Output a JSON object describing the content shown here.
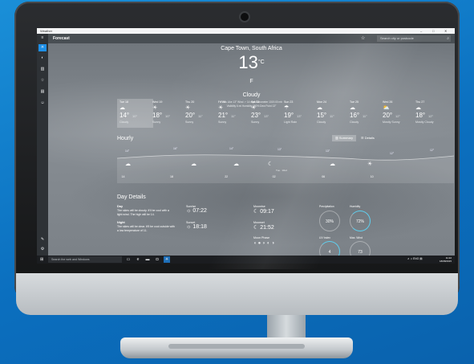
{
  "window": {
    "title": "Weather",
    "min": "–",
    "max": "□",
    "close": "✕"
  },
  "app": {
    "section": "Forecast",
    "search_placeholder": "Search city or postcode"
  },
  "current": {
    "location": "Cape Town, South Africa",
    "temp": "13",
    "unit_c": "°C",
    "unit_f": "F",
    "condition": "Cloudy",
    "stats_line1": "Feels Like 13°   Wind ↗ 14 mph   Barometer 1019.00 mb",
    "stats_line2": "Visibility 6 mi   Humidity 100%   Dew Point 13°"
  },
  "daily": [
    {
      "day": "Tue 18",
      "icon": "☁",
      "hi": "14°",
      "lo": "10°",
      "cond": "Cloudy"
    },
    {
      "day": "Wed 19",
      "icon": "☀",
      "hi": "18°",
      "lo": "10°",
      "cond": "Sunny"
    },
    {
      "day": "Thu 20",
      "icon": "☀",
      "hi": "20°",
      "lo": "11°",
      "cond": "Sunny"
    },
    {
      "day": "Fri 21",
      "icon": "☀",
      "hi": "21°",
      "lo": "11°",
      "cond": "Sunny"
    },
    {
      "day": "Sat 22",
      "icon": "☀",
      "hi": "23°",
      "lo": "13°",
      "cond": "Sunny"
    },
    {
      "day": "Sun 23",
      "icon": "☂",
      "hi": "19°",
      "lo": "13°",
      "cond": "Light Rain"
    },
    {
      "day": "Mon 24",
      "icon": "☁",
      "hi": "15°",
      "lo": "11°",
      "cond": "Cloudy"
    },
    {
      "day": "Tue 25",
      "icon": "☁",
      "hi": "16°",
      "lo": "11°",
      "cond": "Cloudy"
    },
    {
      "day": "Wed 26",
      "icon": "⛅",
      "hi": "20°",
      "lo": "12°",
      "cond": "Mostly Sunny"
    },
    {
      "day": "Thu 27",
      "icon": "☁",
      "hi": "18°",
      "lo": "12°",
      "cond": "Mostly Cloudy"
    }
  ],
  "hourly": {
    "title": "Hourly",
    "summary_label": "Summary",
    "details_label": "Details",
    "temps": [
      "14°",
      "16°",
      "14°",
      "13°",
      "13°",
      "12°",
      "12°"
    ],
    "times": [
      "14",
      "18",
      "22",
      "02",
      "06",
      "10"
    ],
    "icons": [
      "☁",
      "☁",
      "☁",
      "☾",
      "☁",
      "☀"
    ],
    "note": "Tue · Wed"
  },
  "details": {
    "title": "Day Details",
    "day_label": "Day",
    "day_text": "The skies will be cloudy. It'll be cool with a light wind. The high will be 14.",
    "night_label": "Night",
    "night_text": "The skies will be clear. It'll be cool outside with a low temperature of 11.",
    "sunrise_label": "Sunrise",
    "sunrise": "07:22",
    "sunset_label": "Sunset",
    "sunset": "18:18",
    "moonrise_label": "Moonrise",
    "moonrise": "09:17",
    "moonset_label": "Moonset",
    "moonset": "21:52",
    "moonphase_label": "Moon Phase",
    "precip_label": "Precipitation",
    "precip": "30%",
    "humidity_label": "Humidity",
    "humidity": "72%",
    "uv_label": "UV Index",
    "uv": "4",
    "wind_label": "Max. Wind",
    "wind": "73"
  },
  "taskbar": {
    "search": "Search the web and Windows",
    "tray": "∧ ♫ ENG ▤",
    "time": "11:22",
    "date": "18/08/2015"
  }
}
